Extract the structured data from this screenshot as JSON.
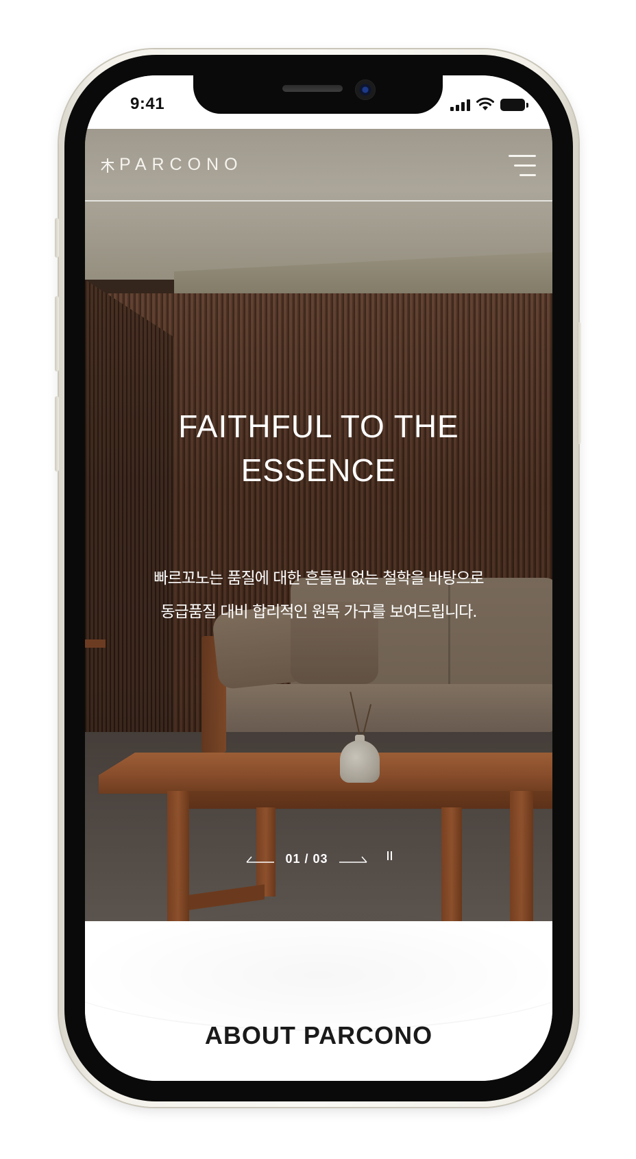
{
  "status_bar": {
    "time": "9:41",
    "icons": [
      "signal-icon",
      "wifi-icon",
      "battery-icon"
    ]
  },
  "header": {
    "logo_mark": "木",
    "logo_text": "PARCONO",
    "menu_icon": "hamburger-menu-icon"
  },
  "hero": {
    "title_line1": "FAITHFUL TO THE",
    "title_line2": "ESSENCE",
    "desc_line1": "빠르꼬노는 품질에 대한 흔들림 없는 철학을 바탕으로",
    "desc_line2": "동급품질 대비 합리적인 원목 가구를 보여드립니다.",
    "slider": {
      "current": "01",
      "separator": "/",
      "total": "03",
      "prev_icon": "arrow-left-icon",
      "next_icon": "arrow-right-icon",
      "pause_icon": "pause-icon"
    }
  },
  "about": {
    "title": "ABOUT PARCONO"
  },
  "colors": {
    "phone_frame": "#f3f1ea",
    "text_light": "#ffffff",
    "text_dark": "#1a1a1a",
    "wood": "#9a5731",
    "wall": "#5a3826"
  }
}
